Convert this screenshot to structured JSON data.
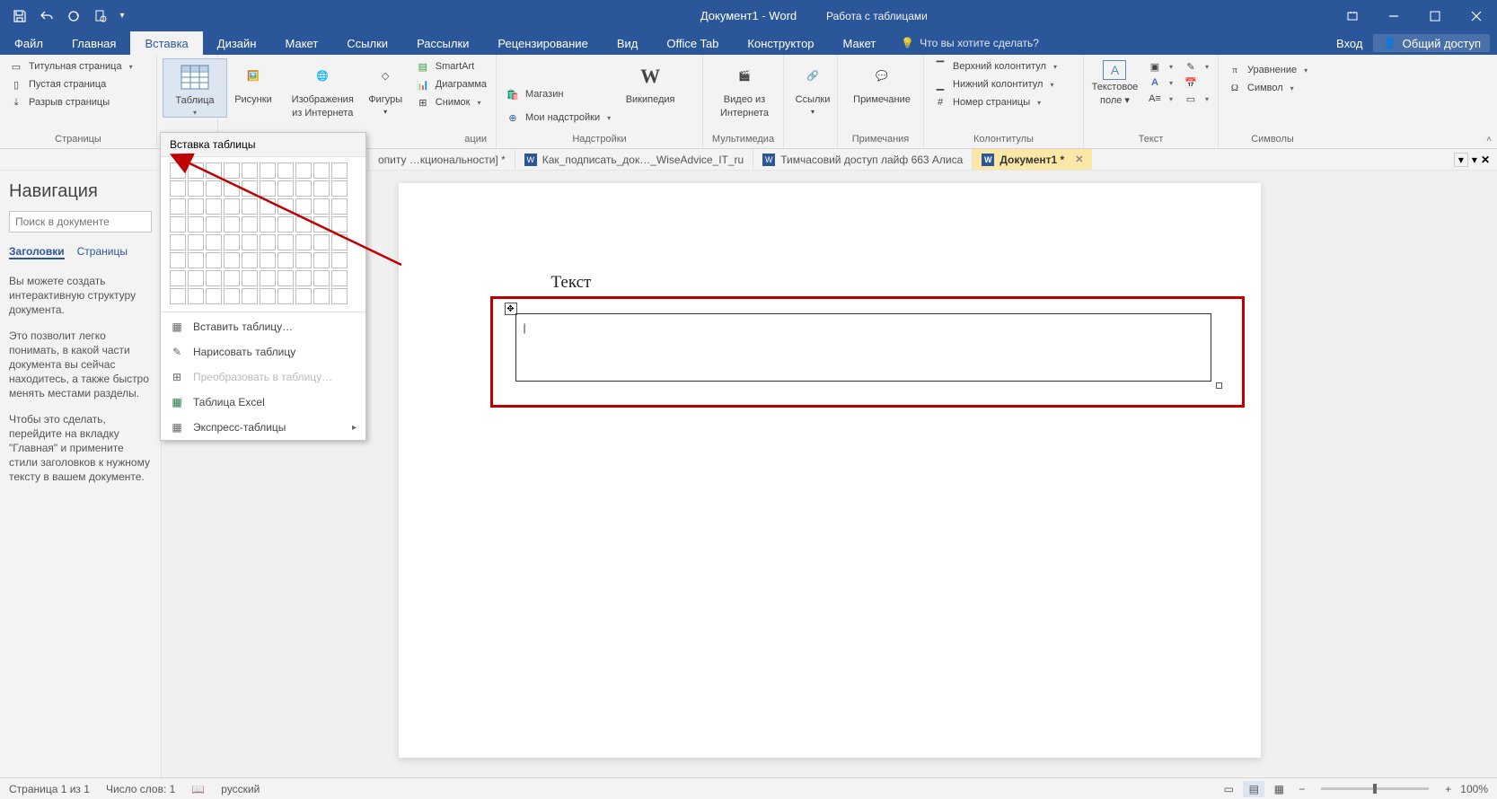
{
  "titlebar": {
    "document_title": "Документ1 - Word",
    "context_title": "Работа с таблицами"
  },
  "menu": {
    "file": "Файл",
    "tabs": [
      "Главная",
      "Вставка",
      "Дизайн",
      "Макет",
      "Ссылки",
      "Рассылки",
      "Рецензирование",
      "Вид",
      "Office Tab",
      "Конструктор",
      "Макет"
    ],
    "active_index": 1,
    "tell_me": "Что вы хотите сделать?",
    "signin": "Вход",
    "share": "Общий доступ"
  },
  "ribbon": {
    "pages": {
      "label": "Страницы",
      "cover": "Титульная страница",
      "blank": "Пустая страница",
      "break": "Разрыв страницы"
    },
    "table": {
      "label": "Таблица"
    },
    "illustrations": {
      "pictures": "Рисунки",
      "online_pictures_l1": "Изображения",
      "online_pictures_l2": "из Интернета",
      "shapes": "Фигуры",
      "smartart": "SmartArt",
      "chart": "Диаграмма",
      "screenshot": "Снимок",
      "group_suffix": "ации"
    },
    "addins": {
      "label": "Надстройки",
      "store": "Магазин",
      "myaddins": "Мои надстройки",
      "wikipedia": "Википедия"
    },
    "media": {
      "label": "Мультимедиа",
      "video_l1": "Видео из",
      "video_l2": "Интернета"
    },
    "links": {
      "label": "Ссылки"
    },
    "comments": {
      "label": "Примечания",
      "btn": "Примечание"
    },
    "headerfooter": {
      "label": "Колонтитулы",
      "header": "Верхний колонтитул",
      "footer": "Нижний колонтитул",
      "pagenum": "Номер страницы"
    },
    "text": {
      "label": "Текст",
      "textbox_l1": "Текстовое",
      "textbox_l2": "поле"
    },
    "symbols": {
      "label": "Символы",
      "equation": "Уравнение",
      "symbol": "Символ"
    }
  },
  "table_dropdown": {
    "header": "Вставка таблицы",
    "insert": "Вставить таблицу…",
    "draw": "Нарисовать таблицу",
    "convert": "Преобразовать в таблицу…",
    "excel": "Таблица Excel",
    "quick": "Экспресс-таблицы"
  },
  "doctabs": {
    "items": [
      "опиту …кциональности] *",
      "Как_подписать_док…_WiseAdvice_IT_ru",
      "Тимчасовий доступ лайф 663 Алиса",
      "Документ1 *"
    ],
    "active_index": 3
  },
  "navigation": {
    "title": "Навигация",
    "search_placeholder": "Поиск в документе",
    "tabs": [
      "Заголовки",
      "Страницы"
    ],
    "active_tab": 0,
    "para1": "Вы можете создать интерактивную структуру документа.",
    "para2": "Это позволит легко понимать, в какой части документа вы сейчас находитесь, а также быстро менять местами разделы.",
    "para3": "Чтобы это сделать, перейдите на вкладку \"Главная\" и примените стили заголовков к нужному тексту в вашем документе."
  },
  "document": {
    "sample_text": "Текст"
  },
  "statusbar": {
    "page": "Страница 1 из 1",
    "words": "Число слов: 1",
    "lang": "русский",
    "zoom": "100%"
  }
}
